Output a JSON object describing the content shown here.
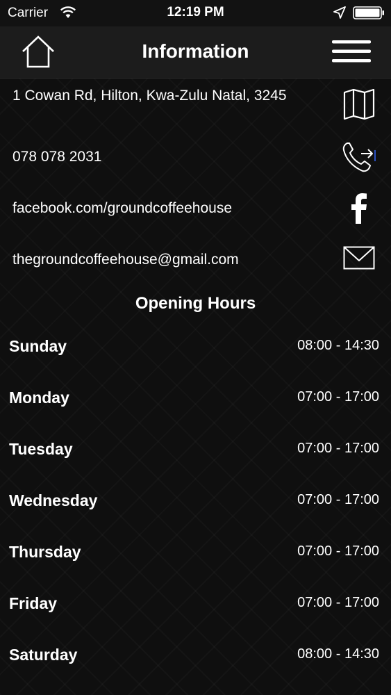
{
  "status_bar": {
    "carrier": "Carrier",
    "time": "12:19 PM"
  },
  "nav": {
    "title": "Information"
  },
  "contacts": {
    "address": "1 Cowan Rd, Hilton, Kwa-Zulu Natal, 3245",
    "phone": "078 078 2031",
    "facebook": "facebook.com/groundcoffeehouse",
    "email": "thegroundcoffeehouse@gmail.com"
  },
  "opening_hours": {
    "title": "Opening Hours",
    "days": [
      {
        "day": "Sunday",
        "hours": "08:00 - 14:30"
      },
      {
        "day": "Monday",
        "hours": "07:00 - 17:00"
      },
      {
        "day": "Tuesday",
        "hours": "07:00 - 17:00"
      },
      {
        "day": "Wednesday",
        "hours": "07:00 - 17:00"
      },
      {
        "day": "Thursday",
        "hours": "07:00 - 17:00"
      },
      {
        "day": "Friday",
        "hours": "07:00 - 17:00"
      },
      {
        "day": "Saturday",
        "hours": "08:00 - 14:30"
      }
    ]
  },
  "colors": {
    "background": "#0f0f0f",
    "nav_background": "#1c1c1c",
    "text": "#ffffff"
  }
}
